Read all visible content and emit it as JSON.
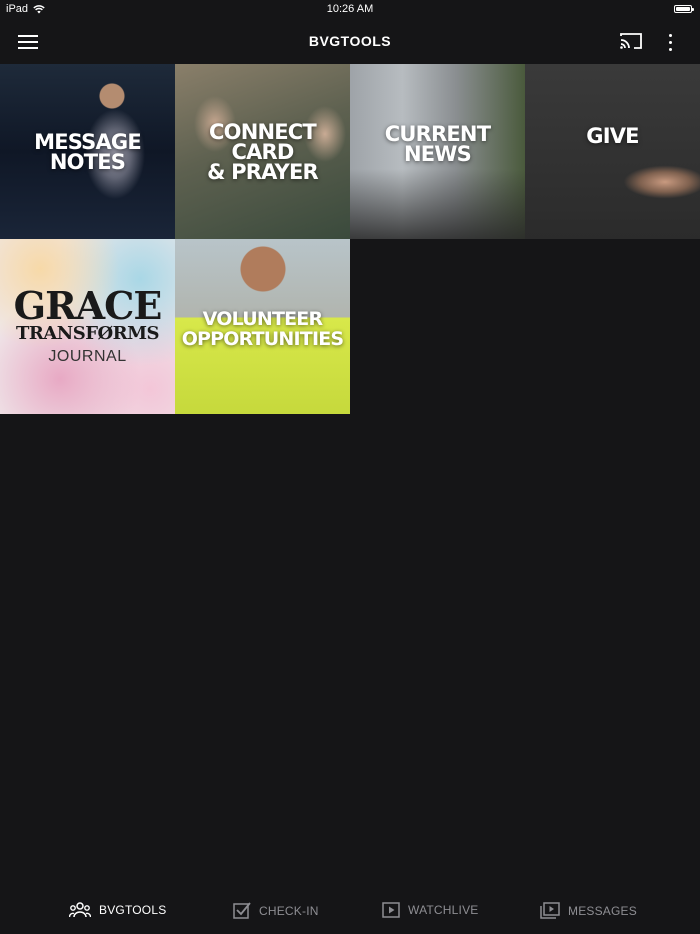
{
  "status_bar": {
    "device": "iPad",
    "time": "10:26 AM"
  },
  "header": {
    "title": "BVGTOOLS"
  },
  "tiles": [
    {
      "label": "MESSAGE\nNOTES"
    },
    {
      "label": "CONNECT\nCARD\n& PRAYER"
    },
    {
      "label": "CURRENT\nNEWS"
    },
    {
      "label": "GIVE"
    },
    {
      "line1": "GRACE",
      "line2": "TRANSFØRMS",
      "line3": "JOURNAL"
    },
    {
      "label": "VOLUNTEER\nOPPORTUNITIES"
    }
  ],
  "tabbar": {
    "tabs": [
      {
        "label": "BVGTOOLS",
        "icon": "people-icon",
        "active": true
      },
      {
        "label": "CHECK-IN",
        "icon": "checkbox-icon",
        "active": false
      },
      {
        "label": "WATCHLIVE",
        "icon": "play-icon",
        "active": false
      },
      {
        "label": "MESSAGES",
        "icon": "video-library-icon",
        "active": false
      }
    ]
  },
  "colors": {
    "background": "#151517",
    "active_tab": "#ffffff",
    "inactive_tab": "#8e8e93"
  }
}
